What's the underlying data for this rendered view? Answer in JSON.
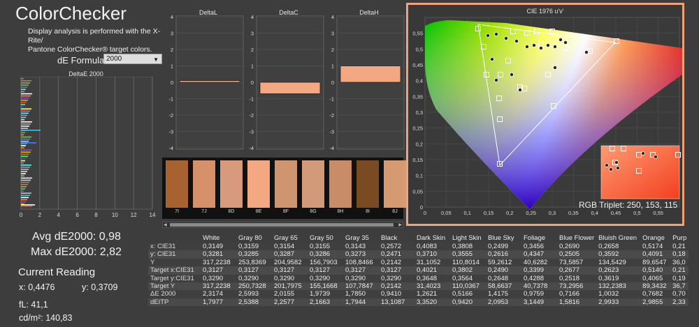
{
  "app": {
    "title": "ColorChecker",
    "description_line1": "Display analysis is performed with the X-Rite/",
    "description_line2": "Pantone ColorChecker® target colors.",
    "de_formula_label": "dE Formula:",
    "de_formula_value": "2000"
  },
  "deltae_chart": {
    "title": "DeltaE 2000",
    "x_ticks": [
      "0",
      "2",
      "4",
      "6",
      "8",
      "10",
      "12",
      "14"
    ]
  },
  "delta_charts": [
    {
      "title": "DeltaL",
      "y_ticks": [
        "4",
        "3",
        "2",
        "1",
        "0",
        "-1",
        "-2",
        "-3",
        "-4"
      ],
      "value": 0.1
    },
    {
      "title": "DeltaC",
      "y_ticks": [
        "4",
        "3",
        "2",
        "1",
        "0",
        "-1",
        "-2",
        "-3",
        "-4"
      ],
      "value": -0.7
    },
    {
      "title": "DeltaH",
      "y_ticks": [
        "4",
        "3",
        "2",
        "1",
        "0",
        "-1",
        "-2",
        "-3",
        "-4"
      ],
      "value": 1.0
    }
  ],
  "colors": {
    "accent": "#f2a27a",
    "bar_fill": "#f4a882"
  },
  "swatches": [
    {
      "label": "7I",
      "color": "#a8622f"
    },
    {
      "label": "7J",
      "color": "#d6906a"
    },
    {
      "label": "8D",
      "color": "#d79a7d"
    },
    {
      "label": "8E",
      "color": "#f4a882"
    },
    {
      "label": "8F",
      "color": "#cf9470"
    },
    {
      "label": "8G",
      "color": "#d29a78"
    },
    {
      "label": "8H",
      "color": "#c98c68"
    },
    {
      "label": "8I",
      "color": "#7a4a22"
    },
    {
      "label": "8J",
      "color": "#d69a72"
    }
  ],
  "stats": {
    "avg": "Avg dE2000: 0,98",
    "max": "Max dE2000: 2,82",
    "current_reading": "Current Reading",
    "x": "x: 0,4476",
    "y": "y: 0,3709",
    "fl": "fL: 41,1",
    "cdm2": "cd/m²: 140,83"
  },
  "cie": {
    "title": "CIE 1976 u'v'",
    "y_ticks": [
      "0,55",
      "0,5",
      "0,45",
      "0,4",
      "0,35",
      "0,3",
      "0,25",
      "0,2",
      "0,15",
      "0,1",
      "0,05",
      "0"
    ],
    "x_ticks": [
      "0",
      "0,05",
      "0,1",
      "0,15",
      "0,2",
      "0,25",
      "0,3",
      "0,35",
      "0,4",
      "0,45",
      "0,5",
      "0,55"
    ],
    "rgb_triplet": "RGB Triplet: 250, 153, 115"
  },
  "table": {
    "columns": [
      "",
      "White",
      "Gray 80",
      "Gray 65",
      "Gray 50",
      "Gray 35",
      "Black",
      "Dark Skin",
      "Light Skin",
      "Blue Sky",
      "Foliage",
      "Blue Flower",
      "Bluish Green",
      "Orange",
      "Purp"
    ],
    "rows": [
      [
        "x: CIE31",
        "0,3149",
        "0,3159",
        "0,3154",
        "0,3155",
        "0,3143",
        "0,2572",
        "0,4083",
        "0,3808",
        "0,2499",
        "0,3456",
        "0,2690",
        "0,2658",
        "0,5174",
        "0,21"
      ],
      [
        "y: CIE31",
        "0,3281",
        "0,3285",
        "0,3287",
        "0,3286",
        "0,3273",
        "0,2471",
        "0,3710",
        "0,3555",
        "0,2616",
        "0,4347",
        "0,2505",
        "0,3592",
        "0,4091",
        "0,18"
      ],
      [
        "Y",
        "317,2238",
        "253,8369",
        "204,9582",
        "156,7903",
        "108,8466",
        "0,2142",
        "31,1052",
        "110,8014",
        "59,2612",
        "40,6282",
        "73,5857",
        "134,5429",
        "89,6547",
        "36,0"
      ],
      [
        "Target x:CIE31",
        "0,3127",
        "0,3127",
        "0,3127",
        "0,3127",
        "0,3127",
        "0,3127",
        "0,4021",
        "0,3802",
        "0,2490",
        "0,3399",
        "0,2677",
        "0,2623",
        "0,5140",
        "0,21"
      ],
      [
        "Target y:CIE31",
        "0,3290",
        "0,3290",
        "0,3290",
        "0,3290",
        "0,3290",
        "0,3290",
        "0,3648",
        "0,3564",
        "0,2648",
        "0,4288",
        "0,2518",
        "0,3619",
        "0,4065",
        "0,19"
      ],
      [
        "Target Y",
        "317,2238",
        "250,7328",
        "201,7975",
        "155,1668",
        "107,7847",
        "0,2142",
        "31,4023",
        "110,0367",
        "58,6637",
        "40,7378",
        "73,2956",
        "132,2383",
        "89,3432",
        "36,7"
      ],
      [
        "ΔE 2000",
        "2,3174",
        "2,5993",
        "2,0155",
        "1,9739",
        "1,7850",
        "0,9410",
        "1,2621",
        "0,5166",
        "1,4175",
        "0,9759",
        "0,7166",
        "1,0032",
        "0,7682",
        "0,70"
      ],
      [
        "dEITP",
        "1,7977",
        "2,5388",
        "2,2577",
        "2,1663",
        "1,7944",
        "13,1087",
        "3,3520",
        "0,9420",
        "2,0953",
        "3,1449",
        "1,5816",
        "2,9933",
        "2,9855",
        "2,33"
      ]
    ]
  }
}
